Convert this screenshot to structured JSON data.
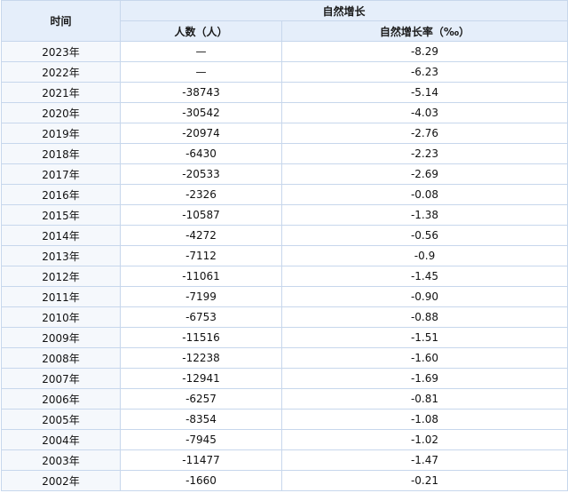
{
  "table": {
    "header": {
      "year": "时间",
      "group": "自然增长",
      "people": "人数（人）",
      "rate": "自然增长率（‰）"
    },
    "rows": [
      {
        "year": "2023年",
        "people": "—",
        "rate": "-8.29"
      },
      {
        "year": "2022年",
        "people": "—",
        "rate": "-6.23"
      },
      {
        "year": "2021年",
        "people": "-38743",
        "rate": "-5.14"
      },
      {
        "year": "2020年",
        "people": "-30542",
        "rate": "-4.03"
      },
      {
        "year": "2019年",
        "people": "-20974",
        "rate": "-2.76"
      },
      {
        "year": "2018年",
        "people": "-6430",
        "rate": "-2.23"
      },
      {
        "year": "2017年",
        "people": "-20533",
        "rate": "-2.69"
      },
      {
        "year": "2016年",
        "people": "-2326",
        "rate": "-0.08"
      },
      {
        "year": "2015年",
        "people": "-10587",
        "rate": "-1.38"
      },
      {
        "year": "2014年",
        "people": "-4272",
        "rate": "-0.56"
      },
      {
        "year": "2013年",
        "people": "-7112",
        "rate": "-0.9"
      },
      {
        "year": "2012年",
        "people": "-11061",
        "rate": "-1.45"
      },
      {
        "year": "2011年",
        "people": "-7199",
        "rate": "-0.90"
      },
      {
        "year": "2010年",
        "people": "-6753",
        "rate": "-0.88"
      },
      {
        "year": "2009年",
        "people": "-11516",
        "rate": "-1.51"
      },
      {
        "year": "2008年",
        "people": "-12238",
        "rate": "-1.60"
      },
      {
        "year": "2007年",
        "people": "-12941",
        "rate": "-1.69"
      },
      {
        "year": "2006年",
        "people": "-6257",
        "rate": "-0.81"
      },
      {
        "year": "2005年",
        "people": "-8354",
        "rate": "-1.08"
      },
      {
        "year": "2004年",
        "people": "-7945",
        "rate": "-1.02"
      },
      {
        "year": "2003年",
        "people": "-11477",
        "rate": "-1.47"
      },
      {
        "year": "2002年",
        "people": "-1660",
        "rate": "-0.21"
      }
    ]
  }
}
